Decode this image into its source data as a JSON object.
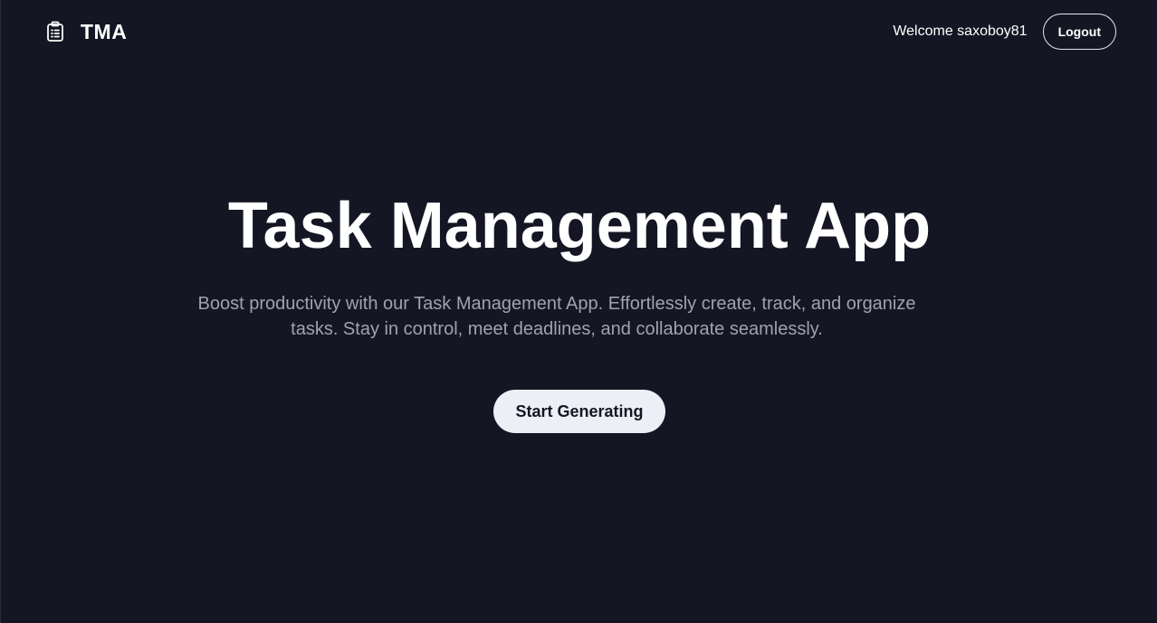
{
  "header": {
    "brand_icon": "clipboard-list-icon",
    "brand_text": "TMA",
    "welcome_text": "Welcome saxoboy81",
    "logout_label": "Logout"
  },
  "hero": {
    "title": "Task Management App",
    "description": "Boost productivity with our Task Management App. Effortlessly create, track, and organize tasks. Stay in control, meet deadlines, and collaborate seamlessly.",
    "cta_label": "Start Generating"
  },
  "colors": {
    "background": "#141624",
    "text_primary": "#ffffff",
    "text_muted": "#9ea2b1",
    "button_light": "#eceff5"
  }
}
